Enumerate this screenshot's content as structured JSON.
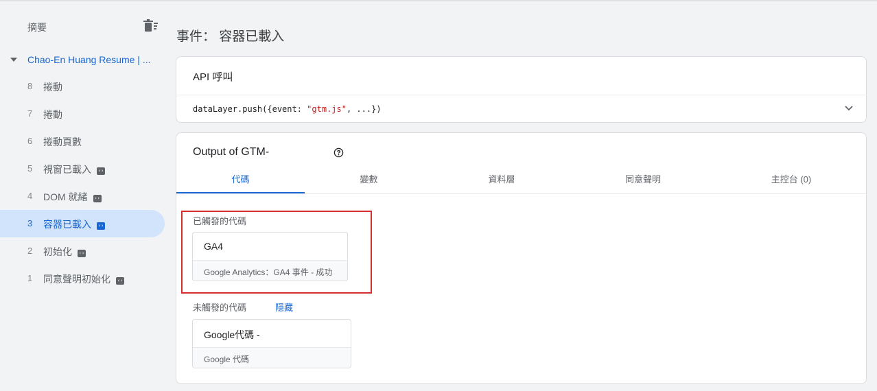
{
  "sidebar": {
    "summary_label": "摘要",
    "container_name": "Chao-En Huang Resume | ...",
    "items": [
      {
        "num": "8",
        "label": "捲動",
        "code": false,
        "active": false
      },
      {
        "num": "7",
        "label": "捲動",
        "code": false,
        "active": false
      },
      {
        "num": "6",
        "label": "捲動頁數",
        "code": false,
        "active": false
      },
      {
        "num": "5",
        "label": "視窗已載入",
        "code": true,
        "active": false
      },
      {
        "num": "4",
        "label": "DOM 就緒",
        "code": true,
        "active": false
      },
      {
        "num": "3",
        "label": "容器已載入",
        "code": true,
        "active": true
      },
      {
        "num": "2",
        "label": "初始化",
        "code": true,
        "active": false
      },
      {
        "num": "1",
        "label": "同意聲明初始化",
        "code": true,
        "active": false
      }
    ]
  },
  "main": {
    "title": "事件： 容器已載入",
    "api_call": {
      "title": "API 呼叫",
      "code_prefix": "dataLayer.push({event: ",
      "code_string": "\"gtm.js\"",
      "code_suffix": ", ...})"
    },
    "output": {
      "title": "Output of GTM-",
      "tabs": [
        "代碼",
        "變數",
        "資料層",
        "同意聲明",
        "主控台 (0)"
      ],
      "fired_label": "已觸發的代碼",
      "fired_tags": [
        {
          "name": "GA4",
          "sub": "Google Analytics：GA4 事件 - 成功"
        }
      ],
      "not_fired_label": "未觸發的代碼",
      "hide_link": "隱藏",
      "not_fired_tags": [
        {
          "name": "Google代碼 -",
          "sub": "Google 代碼"
        }
      ]
    }
  },
  "colors": {
    "accent": "#1967d2",
    "active_bg": "#d2e3fc",
    "highlight": "#d32f2f",
    "code_string": "#c5221f"
  }
}
